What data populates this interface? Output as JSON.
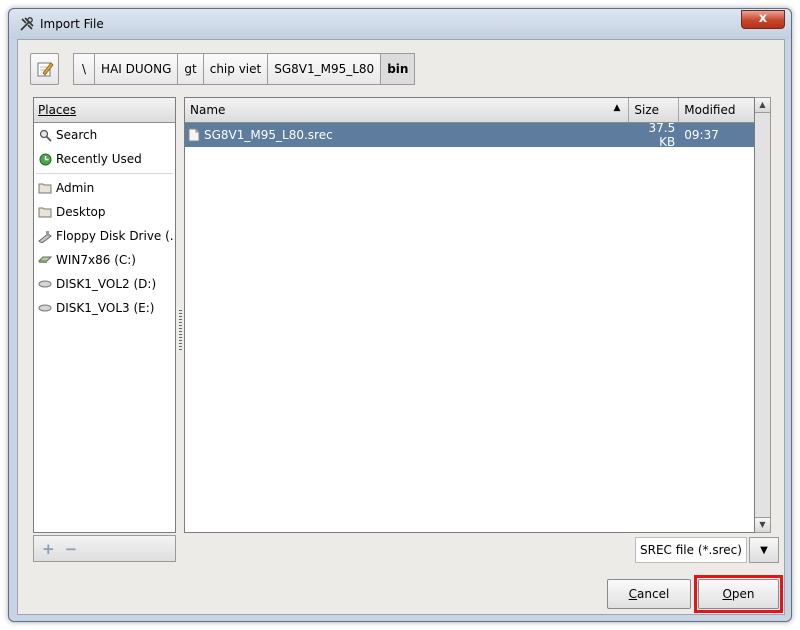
{
  "window": {
    "title": "Import File",
    "close_label": "x"
  },
  "pathbar": {
    "crumbs": [
      {
        "label": "\\"
      },
      {
        "label": "HAI DUONG"
      },
      {
        "label": "gt"
      },
      {
        "label": "chip viet"
      },
      {
        "label": "SG8V1_M95_L80"
      },
      {
        "label": "bin",
        "active": true
      }
    ]
  },
  "places": {
    "header": "Places",
    "items": [
      {
        "label": "Search",
        "icon": "search-icon"
      },
      {
        "label": "Recently Used",
        "icon": "recent-icon"
      },
      {
        "label": "Admin",
        "icon": "folder-icon"
      },
      {
        "label": "Desktop",
        "icon": "folder-icon"
      },
      {
        "label": "Floppy Disk Drive (...",
        "icon": "floppy-icon"
      },
      {
        "label": "WIN7x86 (C:)",
        "icon": "drive-icon"
      },
      {
        "label": "DISK1_VOL2 (D:)",
        "icon": "drive-icon"
      },
      {
        "label": "DISK1_VOL3 (E:)",
        "icon": "drive-icon"
      }
    ],
    "add_symbol": "+",
    "remove_symbol": "−"
  },
  "files": {
    "columns": {
      "name": "Name",
      "size": "Size",
      "modified": "Modified"
    },
    "sort_indicator": "▲",
    "rows": [
      {
        "name": "SG8V1_M95_L80.srec",
        "size": "37.5 KB",
        "modified": "09:37",
        "selected": true
      }
    ]
  },
  "filter": {
    "value": "SREC file (*.srec)",
    "arrow": "▼"
  },
  "buttons": {
    "cancel_first": "C",
    "cancel_rest": "ancel",
    "open_first": "O",
    "open_rest": "pen"
  },
  "colors": {
    "selection": "#5d7c9e",
    "highlight": "#e0161b",
    "dialog": "#ecebe8"
  }
}
